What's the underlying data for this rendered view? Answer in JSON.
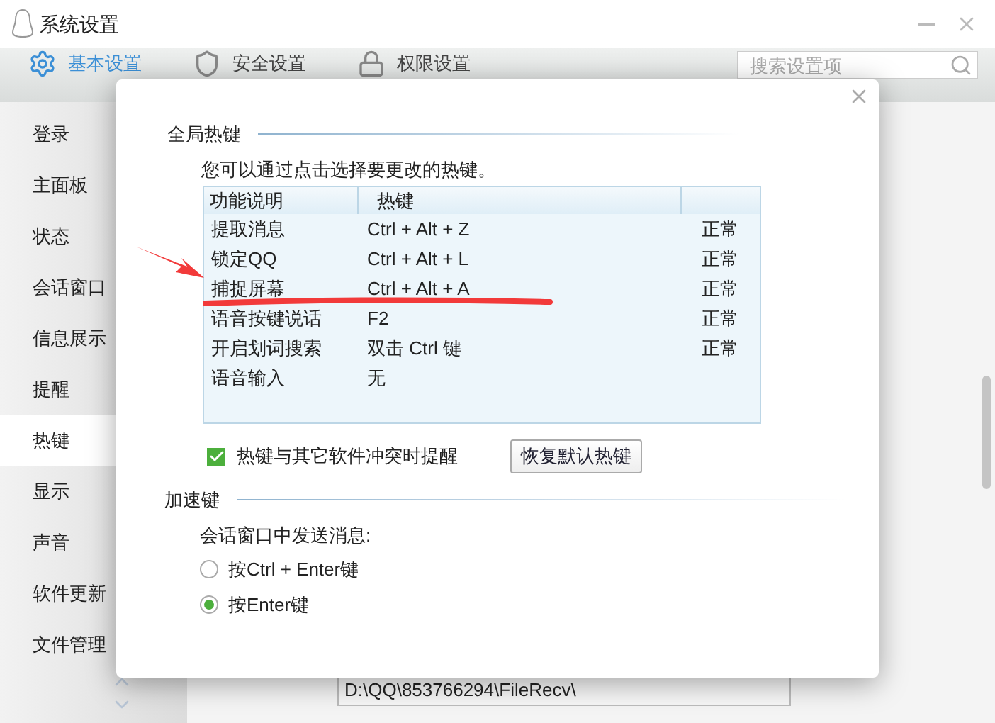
{
  "window": {
    "title": "系统设置"
  },
  "tabs": [
    {
      "label": "基本设置",
      "selected": true,
      "kind": "gear"
    },
    {
      "label": "安全设置",
      "selected": false,
      "kind": "shield"
    },
    {
      "label": "权限设置",
      "selected": false,
      "kind": "lock"
    }
  ],
  "search": {
    "placeholder": "搜索设置项"
  },
  "sidebar": {
    "items": [
      {
        "label": "登录",
        "selected": false
      },
      {
        "label": "主面板",
        "selected": false
      },
      {
        "label": "状态",
        "selected": false
      },
      {
        "label": "会话窗口",
        "selected": false
      },
      {
        "label": "信息展示",
        "selected": false
      },
      {
        "label": "提醒",
        "selected": false
      },
      {
        "label": "热键",
        "selected": true
      },
      {
        "label": "显示",
        "selected": false
      },
      {
        "label": "声音",
        "selected": false
      },
      {
        "label": "软件更新",
        "selected": false
      },
      {
        "label": "文件管理",
        "selected": false
      }
    ]
  },
  "background": {
    "path_field": "D:\\QQ\\853766294\\FileRecv\\"
  },
  "dialog": {
    "global_section": "全局热键",
    "description": "您可以通过点击选择要更改的热键。",
    "table": {
      "columns": [
        "功能说明",
        "热键"
      ],
      "rows": [
        {
          "cells": [
            "提取消息",
            "Ctrl + Alt + Z",
            "正常"
          ]
        },
        {
          "cells": [
            "锁定QQ",
            "Ctrl + Alt + L",
            "正常"
          ]
        },
        {
          "cells": [
            "捕捉屏幕",
            "Ctrl + Alt + A",
            "正常"
          ]
        },
        {
          "cells": [
            "语音按键说话",
            "F2",
            "正常"
          ]
        },
        {
          "cells": [
            "开启划词搜索",
            "双击 Ctrl 键",
            "正常"
          ]
        },
        {
          "cells": [
            "语音输入",
            "无",
            ""
          ]
        }
      ]
    },
    "conflict_checkbox": {
      "label": "热键与其它软件冲突时提醒",
      "checked": true
    },
    "restore_button": "恢复默认热键",
    "accel_section": "加速键",
    "send_label": "会话窗口中发送消息:",
    "send_options": [
      {
        "label": "按Ctrl + Enter键",
        "selected": false
      },
      {
        "label": "按Enter键",
        "selected": true
      }
    ]
  }
}
